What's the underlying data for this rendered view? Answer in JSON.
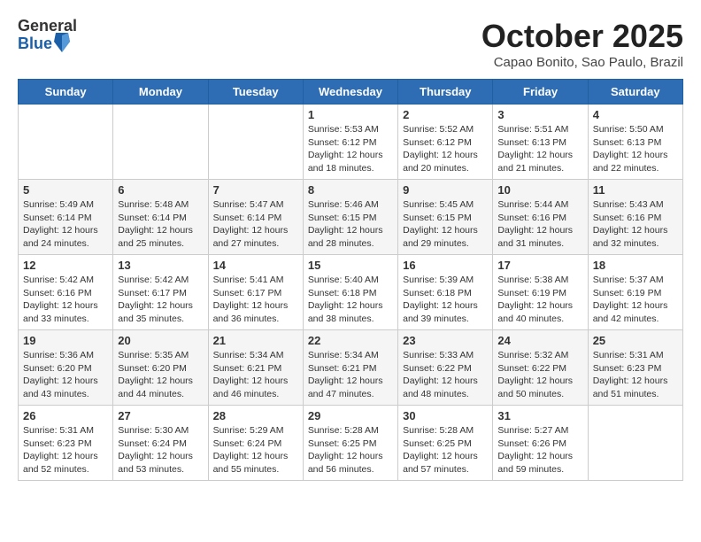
{
  "header": {
    "logo_general": "General",
    "logo_blue": "Blue",
    "month_title": "October 2025",
    "location": "Capao Bonito, Sao Paulo, Brazil"
  },
  "weekdays": [
    "Sunday",
    "Monday",
    "Tuesday",
    "Wednesday",
    "Thursday",
    "Friday",
    "Saturday"
  ],
  "weeks": [
    [
      {
        "day": "",
        "info": ""
      },
      {
        "day": "",
        "info": ""
      },
      {
        "day": "",
        "info": ""
      },
      {
        "day": "1",
        "info": "Sunrise: 5:53 AM\nSunset: 6:12 PM\nDaylight: 12 hours\nand 18 minutes."
      },
      {
        "day": "2",
        "info": "Sunrise: 5:52 AM\nSunset: 6:12 PM\nDaylight: 12 hours\nand 20 minutes."
      },
      {
        "day": "3",
        "info": "Sunrise: 5:51 AM\nSunset: 6:13 PM\nDaylight: 12 hours\nand 21 minutes."
      },
      {
        "day": "4",
        "info": "Sunrise: 5:50 AM\nSunset: 6:13 PM\nDaylight: 12 hours\nand 22 minutes."
      }
    ],
    [
      {
        "day": "5",
        "info": "Sunrise: 5:49 AM\nSunset: 6:14 PM\nDaylight: 12 hours\nand 24 minutes."
      },
      {
        "day": "6",
        "info": "Sunrise: 5:48 AM\nSunset: 6:14 PM\nDaylight: 12 hours\nand 25 minutes."
      },
      {
        "day": "7",
        "info": "Sunrise: 5:47 AM\nSunset: 6:14 PM\nDaylight: 12 hours\nand 27 minutes."
      },
      {
        "day": "8",
        "info": "Sunrise: 5:46 AM\nSunset: 6:15 PM\nDaylight: 12 hours\nand 28 minutes."
      },
      {
        "day": "9",
        "info": "Sunrise: 5:45 AM\nSunset: 6:15 PM\nDaylight: 12 hours\nand 29 minutes."
      },
      {
        "day": "10",
        "info": "Sunrise: 5:44 AM\nSunset: 6:16 PM\nDaylight: 12 hours\nand 31 minutes."
      },
      {
        "day": "11",
        "info": "Sunrise: 5:43 AM\nSunset: 6:16 PM\nDaylight: 12 hours\nand 32 minutes."
      }
    ],
    [
      {
        "day": "12",
        "info": "Sunrise: 5:42 AM\nSunset: 6:16 PM\nDaylight: 12 hours\nand 33 minutes."
      },
      {
        "day": "13",
        "info": "Sunrise: 5:42 AM\nSunset: 6:17 PM\nDaylight: 12 hours\nand 35 minutes."
      },
      {
        "day": "14",
        "info": "Sunrise: 5:41 AM\nSunset: 6:17 PM\nDaylight: 12 hours\nand 36 minutes."
      },
      {
        "day": "15",
        "info": "Sunrise: 5:40 AM\nSunset: 6:18 PM\nDaylight: 12 hours\nand 38 minutes."
      },
      {
        "day": "16",
        "info": "Sunrise: 5:39 AM\nSunset: 6:18 PM\nDaylight: 12 hours\nand 39 minutes."
      },
      {
        "day": "17",
        "info": "Sunrise: 5:38 AM\nSunset: 6:19 PM\nDaylight: 12 hours\nand 40 minutes."
      },
      {
        "day": "18",
        "info": "Sunrise: 5:37 AM\nSunset: 6:19 PM\nDaylight: 12 hours\nand 42 minutes."
      }
    ],
    [
      {
        "day": "19",
        "info": "Sunrise: 5:36 AM\nSunset: 6:20 PM\nDaylight: 12 hours\nand 43 minutes."
      },
      {
        "day": "20",
        "info": "Sunrise: 5:35 AM\nSunset: 6:20 PM\nDaylight: 12 hours\nand 44 minutes."
      },
      {
        "day": "21",
        "info": "Sunrise: 5:34 AM\nSunset: 6:21 PM\nDaylight: 12 hours\nand 46 minutes."
      },
      {
        "day": "22",
        "info": "Sunrise: 5:34 AM\nSunset: 6:21 PM\nDaylight: 12 hours\nand 47 minutes."
      },
      {
        "day": "23",
        "info": "Sunrise: 5:33 AM\nSunset: 6:22 PM\nDaylight: 12 hours\nand 48 minutes."
      },
      {
        "day": "24",
        "info": "Sunrise: 5:32 AM\nSunset: 6:22 PM\nDaylight: 12 hours\nand 50 minutes."
      },
      {
        "day": "25",
        "info": "Sunrise: 5:31 AM\nSunset: 6:23 PM\nDaylight: 12 hours\nand 51 minutes."
      }
    ],
    [
      {
        "day": "26",
        "info": "Sunrise: 5:31 AM\nSunset: 6:23 PM\nDaylight: 12 hours\nand 52 minutes."
      },
      {
        "day": "27",
        "info": "Sunrise: 5:30 AM\nSunset: 6:24 PM\nDaylight: 12 hours\nand 53 minutes."
      },
      {
        "day": "28",
        "info": "Sunrise: 5:29 AM\nSunset: 6:24 PM\nDaylight: 12 hours\nand 55 minutes."
      },
      {
        "day": "29",
        "info": "Sunrise: 5:28 AM\nSunset: 6:25 PM\nDaylight: 12 hours\nand 56 minutes."
      },
      {
        "day": "30",
        "info": "Sunrise: 5:28 AM\nSunset: 6:25 PM\nDaylight: 12 hours\nand 57 minutes."
      },
      {
        "day": "31",
        "info": "Sunrise: 5:27 AM\nSunset: 6:26 PM\nDaylight: 12 hours\nand 59 minutes."
      },
      {
        "day": "",
        "info": ""
      }
    ]
  ]
}
